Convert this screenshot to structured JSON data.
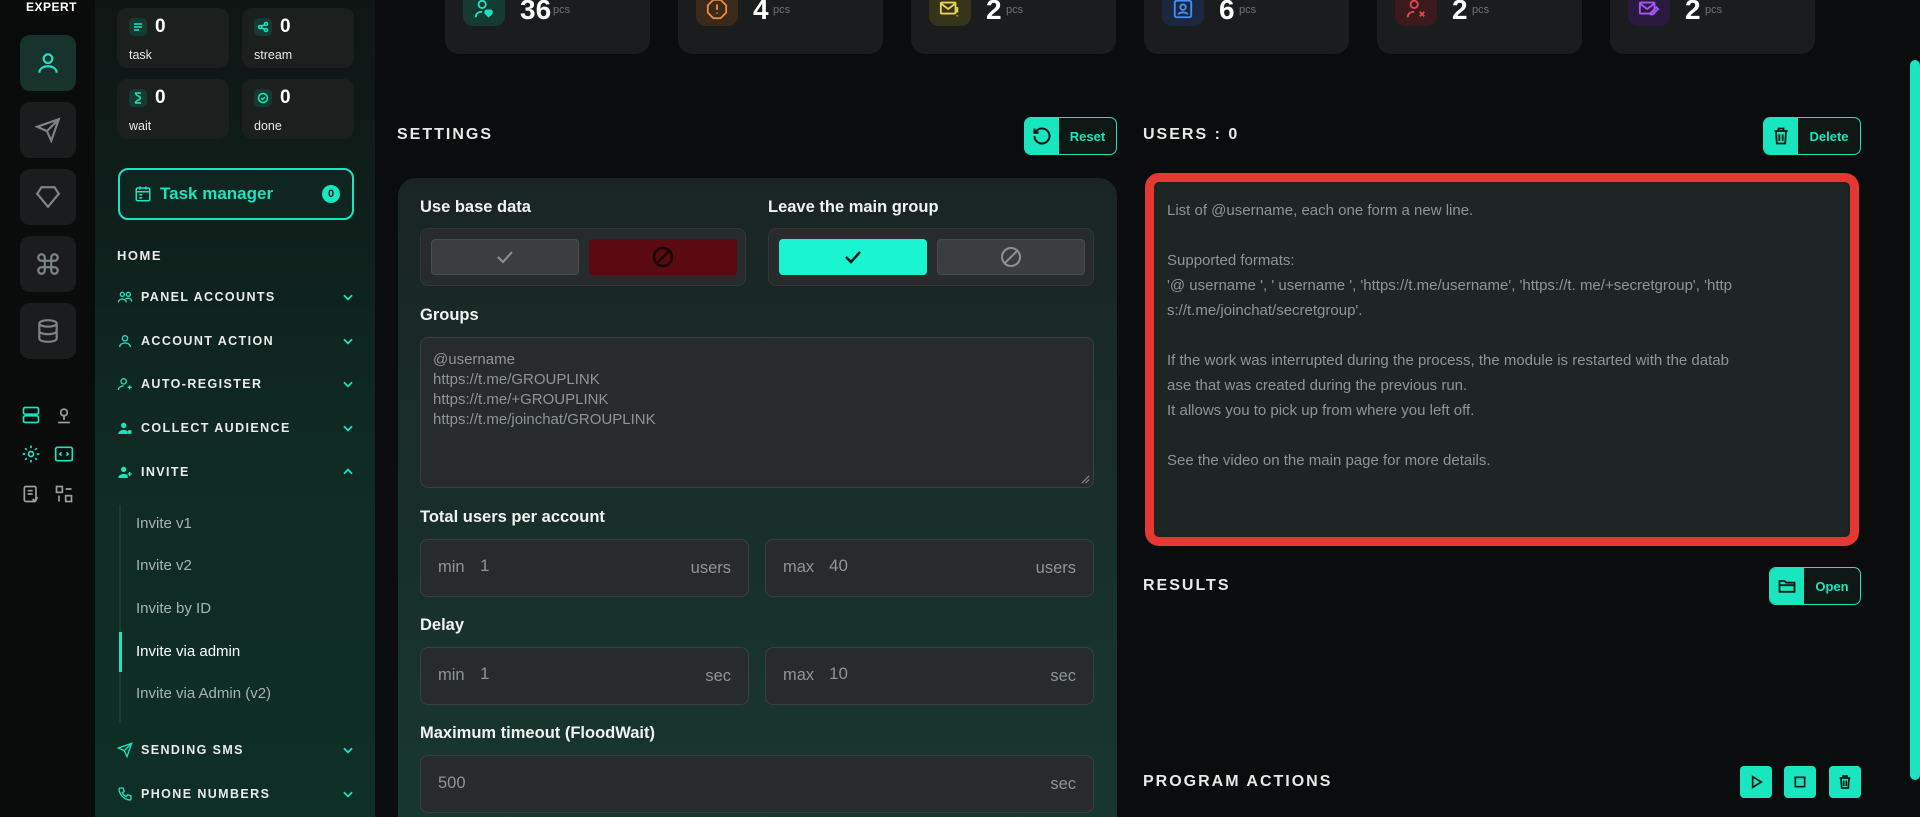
{
  "app": {
    "brand": "EXPERT"
  },
  "sidebar_stats": [
    {
      "value": "0",
      "label": "task",
      "icon": "task-icon"
    },
    {
      "value": "0",
      "label": "stream",
      "icon": "share-icon"
    },
    {
      "value": "0",
      "label": "wait",
      "icon": "hourglass-icon"
    },
    {
      "value": "0",
      "label": "done",
      "icon": "check-circle-icon"
    }
  ],
  "task_manager": {
    "label": "Task manager",
    "count": "0"
  },
  "nav": {
    "home": "HOME",
    "items": [
      {
        "label": "PANEL ACCOUNTS",
        "icon": "users-icon",
        "expanded": false
      },
      {
        "label": "ACCOUNT ACTION",
        "icon": "user-icon",
        "expanded": false
      },
      {
        "label": "AUTO-REGISTER",
        "icon": "user-plus-icon",
        "expanded": false
      },
      {
        "label": "COLLECT AUDIENCE",
        "icon": "user-gear-icon",
        "expanded": false
      },
      {
        "label": "INVITE",
        "icon": "user-add-icon",
        "expanded": true
      },
      {
        "label": "SENDING SMS",
        "icon": "send-icon",
        "expanded": false
      },
      {
        "label": "PHONE NUMBERS",
        "icon": "phone-icon",
        "expanded": false
      }
    ],
    "invite_sub": [
      {
        "label": "Invite v1",
        "active": false
      },
      {
        "label": "Invite v2",
        "active": false
      },
      {
        "label": "Invite by ID",
        "active": false
      },
      {
        "label": "Invite via admin",
        "active": true
      },
      {
        "label": "Invite via Admin (v2)",
        "active": false
      }
    ]
  },
  "top_stats": [
    {
      "value": "36",
      "unit": "pcs",
      "icon": "user-heart-icon",
      "color": "#19e5bf"
    },
    {
      "value": "4",
      "unit": "pcs",
      "icon": "warning-octagon-icon",
      "color": "#f08a3a"
    },
    {
      "value": "2",
      "unit": "pcs",
      "icon": "mail-warning-icon",
      "color": "#e8d44d"
    },
    {
      "value": "6",
      "unit": "pcs",
      "icon": "id-card-icon",
      "color": "#4a8cf0"
    },
    {
      "value": "2",
      "unit": "pcs",
      "icon": "user-x-icon",
      "color": "#e5484d"
    },
    {
      "value": "2",
      "unit": "pcs",
      "icon": "mail-edit-icon",
      "color": "#a855f7"
    }
  ],
  "settings": {
    "title": "SETTINGS",
    "reset_label": "Reset",
    "use_base_data": {
      "label": "Use base data",
      "selected": "off"
    },
    "leave_main_group": {
      "label": "Leave the main group",
      "selected": "on"
    },
    "groups": {
      "label": "Groups",
      "placeholder_lines": [
        "@username",
        "https://t.me/GROUPLINK",
        "https://t.me/+GROUPLINK",
        "https://t.me/joinchat/GROUPLINK"
      ]
    },
    "total_users": {
      "label": "Total users per account",
      "min_prefix": "min",
      "min_value": "1",
      "max_prefix": "max",
      "max_value": "40",
      "unit": "users"
    },
    "delay": {
      "label": "Delay",
      "min_prefix": "min",
      "min_value": "1",
      "max_prefix": "max",
      "max_value": "10",
      "unit": "sec"
    },
    "floodwait": {
      "label": "Maximum timeout (FloodWait)",
      "placeholder": "500",
      "unit": "sec"
    }
  },
  "users": {
    "title": "USERS : 0",
    "delete_label": "Delete",
    "placeholder_lines": [
      "List of @username, each one form a new line.",
      "",
      "Supported formats:",
      "'@ username ', ' username ', 'https://t.me/username', 'https://t. me/+secretgroup', 'http",
      "s://t.me/joinchat/secretgroup'.",
      "",
      "If the work was interrupted during the process, the module is restarted with the datab",
      "ase that was created during the previous run.",
      "It allows you to pick up from where you left off.",
      "",
      "See the video on the main page for more details."
    ]
  },
  "results": {
    "title": "RESULTS",
    "open_label": "Open"
  },
  "program_actions": {
    "title": "PROGRAM ACTIONS"
  },
  "colors": {
    "accent": "#19e5bf",
    "danger": "#e53832"
  }
}
